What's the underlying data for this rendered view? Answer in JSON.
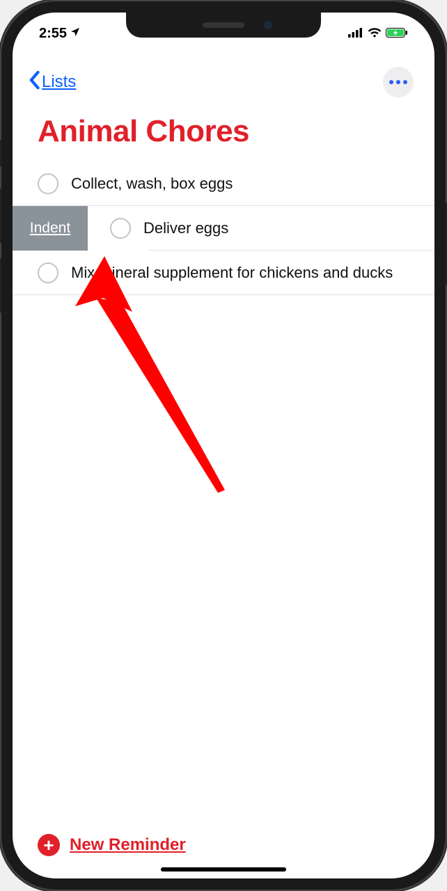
{
  "statusbar": {
    "time": "2:55",
    "location_icon": "location-arrow",
    "signal_bars": 4,
    "wifi": true,
    "battery_charging": true
  },
  "nav": {
    "back_label": "Lists",
    "more_label": "More"
  },
  "list_title": "Animal Chores",
  "reminders": [
    {
      "text": "Collect, wash, box eggs",
      "completed": false,
      "indented": false
    },
    {
      "text": "Deliver eggs",
      "completed": false,
      "indented": true,
      "swipe_action": "Indent"
    },
    {
      "text": "Mix mineral supplement for chickens and ducks",
      "completed": false,
      "indented": false
    }
  ],
  "swipe_action_label": "Indent",
  "footer": {
    "new_reminder_label": "New Reminder"
  },
  "annotation": {
    "type": "arrow",
    "color": "#ff0000",
    "target": "indent-swipe-action"
  }
}
